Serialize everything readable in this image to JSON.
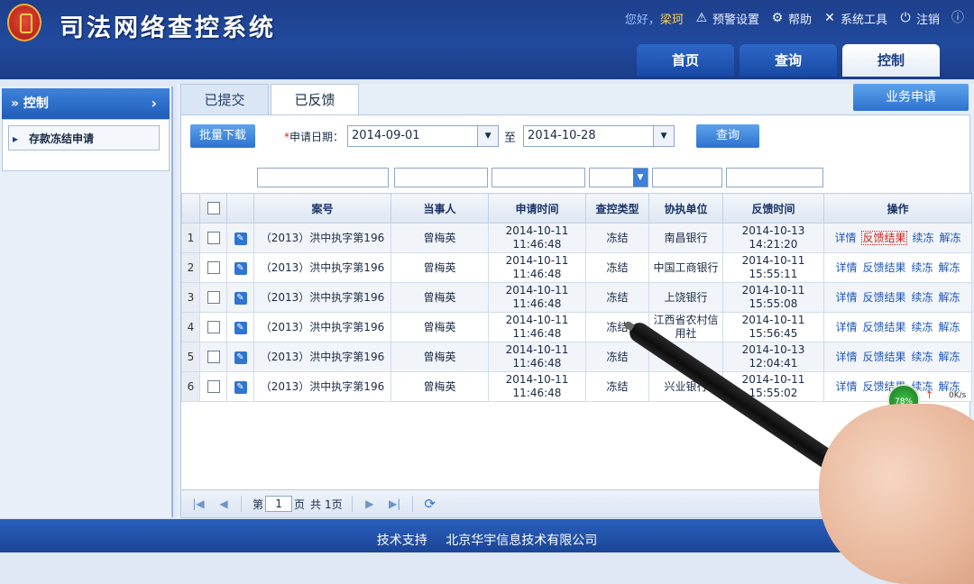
{
  "header": {
    "title": "司法网络查控系统",
    "greeting": "您好，",
    "user": "梁珂",
    "links": [
      {
        "label": "预警设置",
        "icon": "warning-icon"
      },
      {
        "label": "帮助",
        "icon": "gear-icon"
      },
      {
        "label": "系统工具",
        "icon": "tools-icon"
      },
      {
        "label": "注销",
        "icon": "power-icon"
      }
    ],
    "nav": [
      {
        "label": "首页",
        "active": false
      },
      {
        "label": "查询",
        "active": false
      },
      {
        "label": "控制",
        "active": true
      }
    ]
  },
  "sidebar": {
    "title": "控制",
    "items": [
      {
        "label": "存款冻结申请"
      }
    ]
  },
  "main": {
    "tabs": [
      {
        "label": "已提交",
        "active": false
      },
      {
        "label": "已反馈",
        "active": true
      }
    ],
    "action_button": "业务申请",
    "filter": {
      "batch_download": "批量下载",
      "required_mark": "*",
      "date_label": "申请日期：",
      "date_from": "2014-09-01",
      "to_label": "至",
      "date_to": "2014-10-28",
      "query_button": "查询"
    },
    "table": {
      "headers": [
        "案号",
        "当事人",
        "申请时间",
        "查控类型",
        "协执单位",
        "反馈时间",
        "操作"
      ],
      "actions": [
        "详情",
        "反馈结果",
        "续冻",
        "解冻"
      ],
      "rows": [
        {
          "no": "1",
          "case": "（2013）洪中执字第196",
          "party": "曾梅英",
          "apply_time": "2014-10-11 11:46:48",
          "type": "冻结",
          "unit": "南昌银行",
          "feedback_time": "2014-10-13 14:21:20"
        },
        {
          "no": "2",
          "case": "（2013）洪中执字第196",
          "party": "曾梅英",
          "apply_time": "2014-10-11 11:46:48",
          "type": "冻结",
          "unit": "中国工商银行",
          "feedback_time": "2014-10-11 15:55:11"
        },
        {
          "no": "3",
          "case": "（2013）洪中执字第196",
          "party": "曾梅英",
          "apply_time": "2014-10-11 11:46:48",
          "type": "冻结",
          "unit": "上饶银行",
          "feedback_time": "2014-10-11 15:55:08"
        },
        {
          "no": "4",
          "case": "（2013）洪中执字第196",
          "party": "曾梅英",
          "apply_time": "2014-10-11 11:46:48",
          "type": "冻结",
          "unit": "江西省农村信用社",
          "feedback_time": "2014-10-11 15:56:45"
        },
        {
          "no": "5",
          "case": "（2013）洪中执字第196",
          "party": "曾梅英",
          "apply_time": "2014-10-11 11:46:48",
          "type": "冻结",
          "unit": "",
          "feedback_time": "2014-10-13 12:04:41"
        },
        {
          "no": "6",
          "case": "（2013）洪中执字第196",
          "party": "曾梅英",
          "apply_time": "2014-10-11 11:46:48",
          "type": "冻结",
          "unit": "兴业银行",
          "feedback_time": "2014-10-11 15:55:02"
        }
      ]
    },
    "pager": {
      "prefix": "第",
      "page": "1",
      "suffix": "页",
      "total_prefix": "共",
      "total": "1页"
    }
  },
  "widget": {
    "percent": "78%",
    "speed": "0K/s"
  },
  "footer": {
    "label": "技术支持",
    "company": "北京华宇信息技术有限公司"
  }
}
